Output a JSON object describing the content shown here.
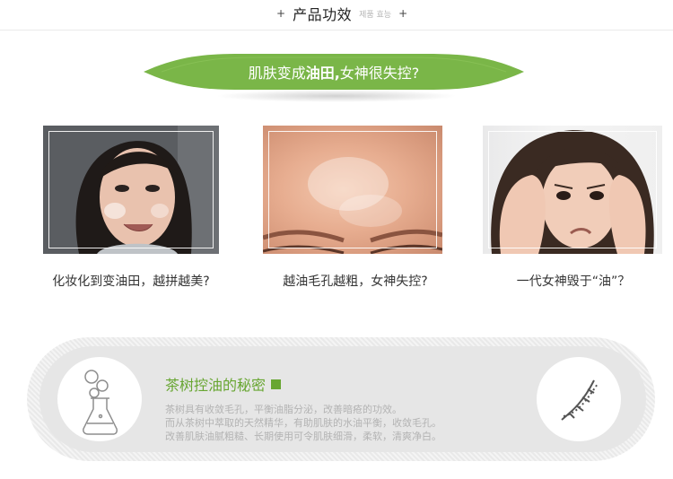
{
  "header": {
    "title": "产品功效",
    "subtitle_korean": "제품 효능",
    "decorations": [
      "+",
      "+"
    ]
  },
  "banner": {
    "text_before": "肌肤变成",
    "text_bold": "油田,",
    "text_after": "女神很失控?",
    "color": "#7ab648"
  },
  "photos": [
    {
      "caption": "化妆化到变油田，越拼越美?"
    },
    {
      "caption": "越油毛孔越粗，女神失控?"
    },
    {
      "caption": "一代女神毁于“油”？"
    }
  ],
  "secret": {
    "title": "茶树控油的秘密",
    "accent_color": "#68a632",
    "lines": [
      "茶树具有收敛毛孔，平衡油脂分泌，改善暗疮的功效。",
      "而从茶树中萃取的天然精华，有助肌肤的水油平衡，收敛毛孔。",
      "改善肌肤油腻粗糙、长期使用可令肌肤细滑，柔软，清爽净白。"
    ],
    "left_icon": "flask-icon",
    "right_icon": "dna-icon"
  }
}
